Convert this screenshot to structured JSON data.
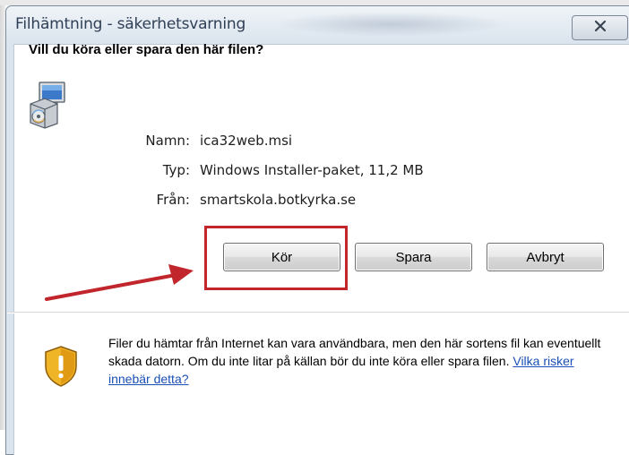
{
  "window": {
    "title": "Filhämtning - säkerhetsvarning"
  },
  "dialog": {
    "question": "Vill du köra eller spara den här filen?",
    "file": {
      "name_label": "Namn:",
      "name_value": "ica32web.msi",
      "type_label": "Typ:",
      "type_value": "Windows Installer-paket, 11,2 MB",
      "from_label": "Från:",
      "from_value": "smartskola.botkyrka.se"
    },
    "buttons": {
      "run": "Kör",
      "save": "Spara",
      "cancel": "Avbryt"
    },
    "warning": {
      "text": "Filer du hämtar från Internet kan vara användbara, men den här sortens fil kan eventuellt skada datorn. Om du inte litar på källan bör du inte köra eller spara filen.",
      "link": "Vilka risker innebär detta?"
    }
  },
  "icons": {
    "close": "close-icon",
    "file": "installer-package-icon",
    "shield": "security-shield-icon"
  },
  "colors": {
    "annotation": "#c0262c",
    "link": "#1a4fb5"
  }
}
